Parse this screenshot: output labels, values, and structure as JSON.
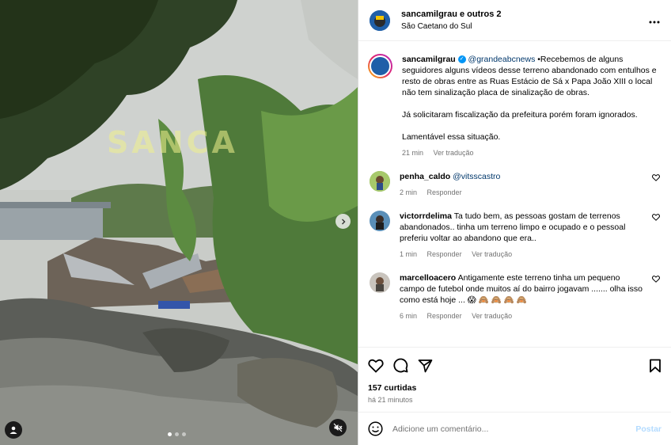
{
  "media": {
    "watermark": "SANCA",
    "slide_count": 3,
    "active_slide": 1
  },
  "header": {
    "title": "sancamilgrau e outros 2",
    "location": "São Caetano do Sul",
    "more_icon": "more-horizontal-icon"
  },
  "post": {
    "username": "sancamilgrau",
    "mention": "@grandeabcnews",
    "caption_1": " •Recebemos de alguns seguidores alguns vídeos desse terreno abandonado com entulhos e resto de obras entre as Ruas Estácio de Sá x Papa João XIII o local não tem sinalização placa de sinalização de obras.",
    "caption_2": "Já solicitaram fiscalização da prefeitura porém foram ignorados.",
    "caption_3": "Lamentável essa situação.",
    "time": "21 min",
    "translate": "Ver tradução"
  },
  "comments": [
    {
      "username": "penha_caldo",
      "text": "@vitsscastro",
      "time": "2 min",
      "reply": "Responder",
      "translate": ""
    },
    {
      "username": "victorrdelima",
      "text": "Ta tudo bem, as pessoas gostam de terrenos abandonados.. tinha um terreno limpo e ocupado e o pessoal preferiu voltar ao abandono que era..",
      "time": "1 min",
      "reply": "Responder",
      "translate": "Ver tradução"
    },
    {
      "username": "marcelloacero",
      "text": "Antigamente este terreno tinha um pequeno campo de futebol onde muitos aí do bairro jogavam ....... olha isso como está hoje ... 😱 🙈 🙈 🙈 🙈",
      "time": "6 min",
      "reply": "Responder",
      "translate": "Ver tradução"
    }
  ],
  "likes": "157 curtidas",
  "posted": "há 21 minutos",
  "add_comment": {
    "placeholder": "Adicione um comentário...",
    "post_label": "Postar"
  },
  "colors": {
    "link": "#00376b",
    "verified": "#0095f6",
    "muted": "#737373",
    "post_disabled": "#b3dbff"
  }
}
